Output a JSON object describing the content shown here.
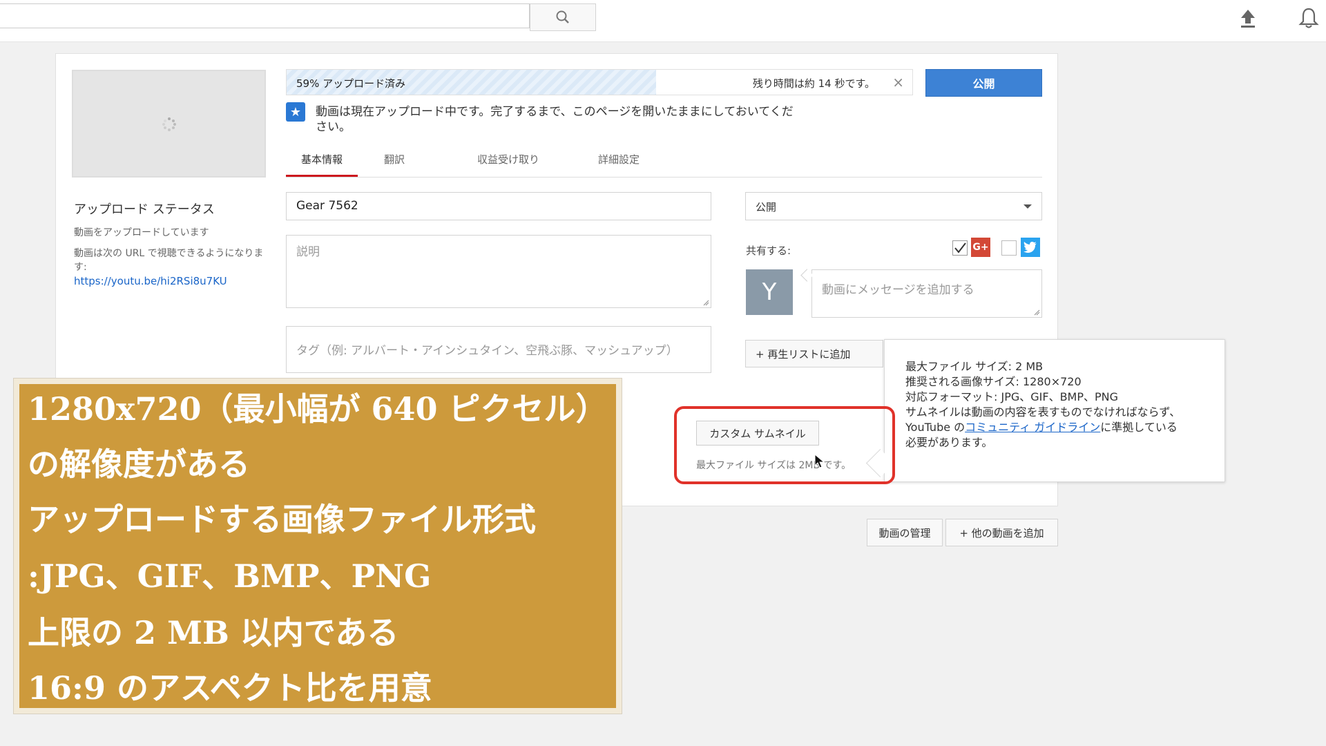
{
  "header": {
    "search_placeholder": "",
    "icons": [
      "search-icon",
      "upload-icon",
      "bell-icon"
    ]
  },
  "upload": {
    "progress_label": "59% アップロード済み",
    "progress_percent": 59,
    "remaining": "残り時間は約 14 秒です。",
    "close": "×",
    "publish_label": "公開",
    "notice": "動画は現在アップロード中です。完了するまで、このページを開いたままにしておいてください。"
  },
  "status": {
    "title": "アップロード ステータス",
    "text": "動画をアップロードしています",
    "url_note": "動画は次の URL で視聴できるようになります:",
    "url": "https://youtu.be/hi2RSi8u7KU"
  },
  "tabs": [
    {
      "label": "基本情報",
      "active": true
    },
    {
      "label": "翻訳"
    },
    {
      "label": "収益受け取り"
    },
    {
      "label": "詳細設定"
    }
  ],
  "form": {
    "title_value": "Gear   7562",
    "description_placeholder": "説明",
    "tags_placeholder": "タグ（例: アルバート・アインシュタイン、空飛ぶ豚、マッシュアップ）",
    "privacy_value": "公開",
    "share_label": "共有する:",
    "gplus_label": "G+",
    "avatar_letter": "Y",
    "message_placeholder": "動画にメッセージを追加する",
    "playlist_label": "+ 再生リストに追加"
  },
  "thumbnail": {
    "custom_label": "カスタム サムネイル",
    "max_size_text": "最大ファイル サイズは 2MB です。"
  },
  "tooltip": {
    "line1": "最大ファイル サイズ: 2 MB",
    "line2": "推奨される画像サイズ: 1280×720",
    "line3": "対応フォーマット: JPG、GIF、BMP、PNG",
    "line4": "サムネイルは動画の内容を表すものでなければならず、",
    "line5_pre": "YouTube の",
    "line5_link": "コミュニティ ガイドライン",
    "line5_post": "に準拠している",
    "line6": "必要があります。"
  },
  "footer_buttons": {
    "manage": "動画の管理",
    "add": "+ 他の動画を追加"
  },
  "overlay": {
    "lines": [
      "1280x720（最小幅が 640 ピクセル）",
      "の解像度がある",
      "アップロードする画像ファイル形式",
      ":JPG、GIF、BMP、PNG",
      "上限の 2 MB 以内である",
      " 16:9 のアスペクト比を用意"
    ]
  },
  "colors": {
    "publish": "#3d82d5",
    "accent_red": "#e0322a",
    "overlay_bg": "#cd9a3c"
  }
}
